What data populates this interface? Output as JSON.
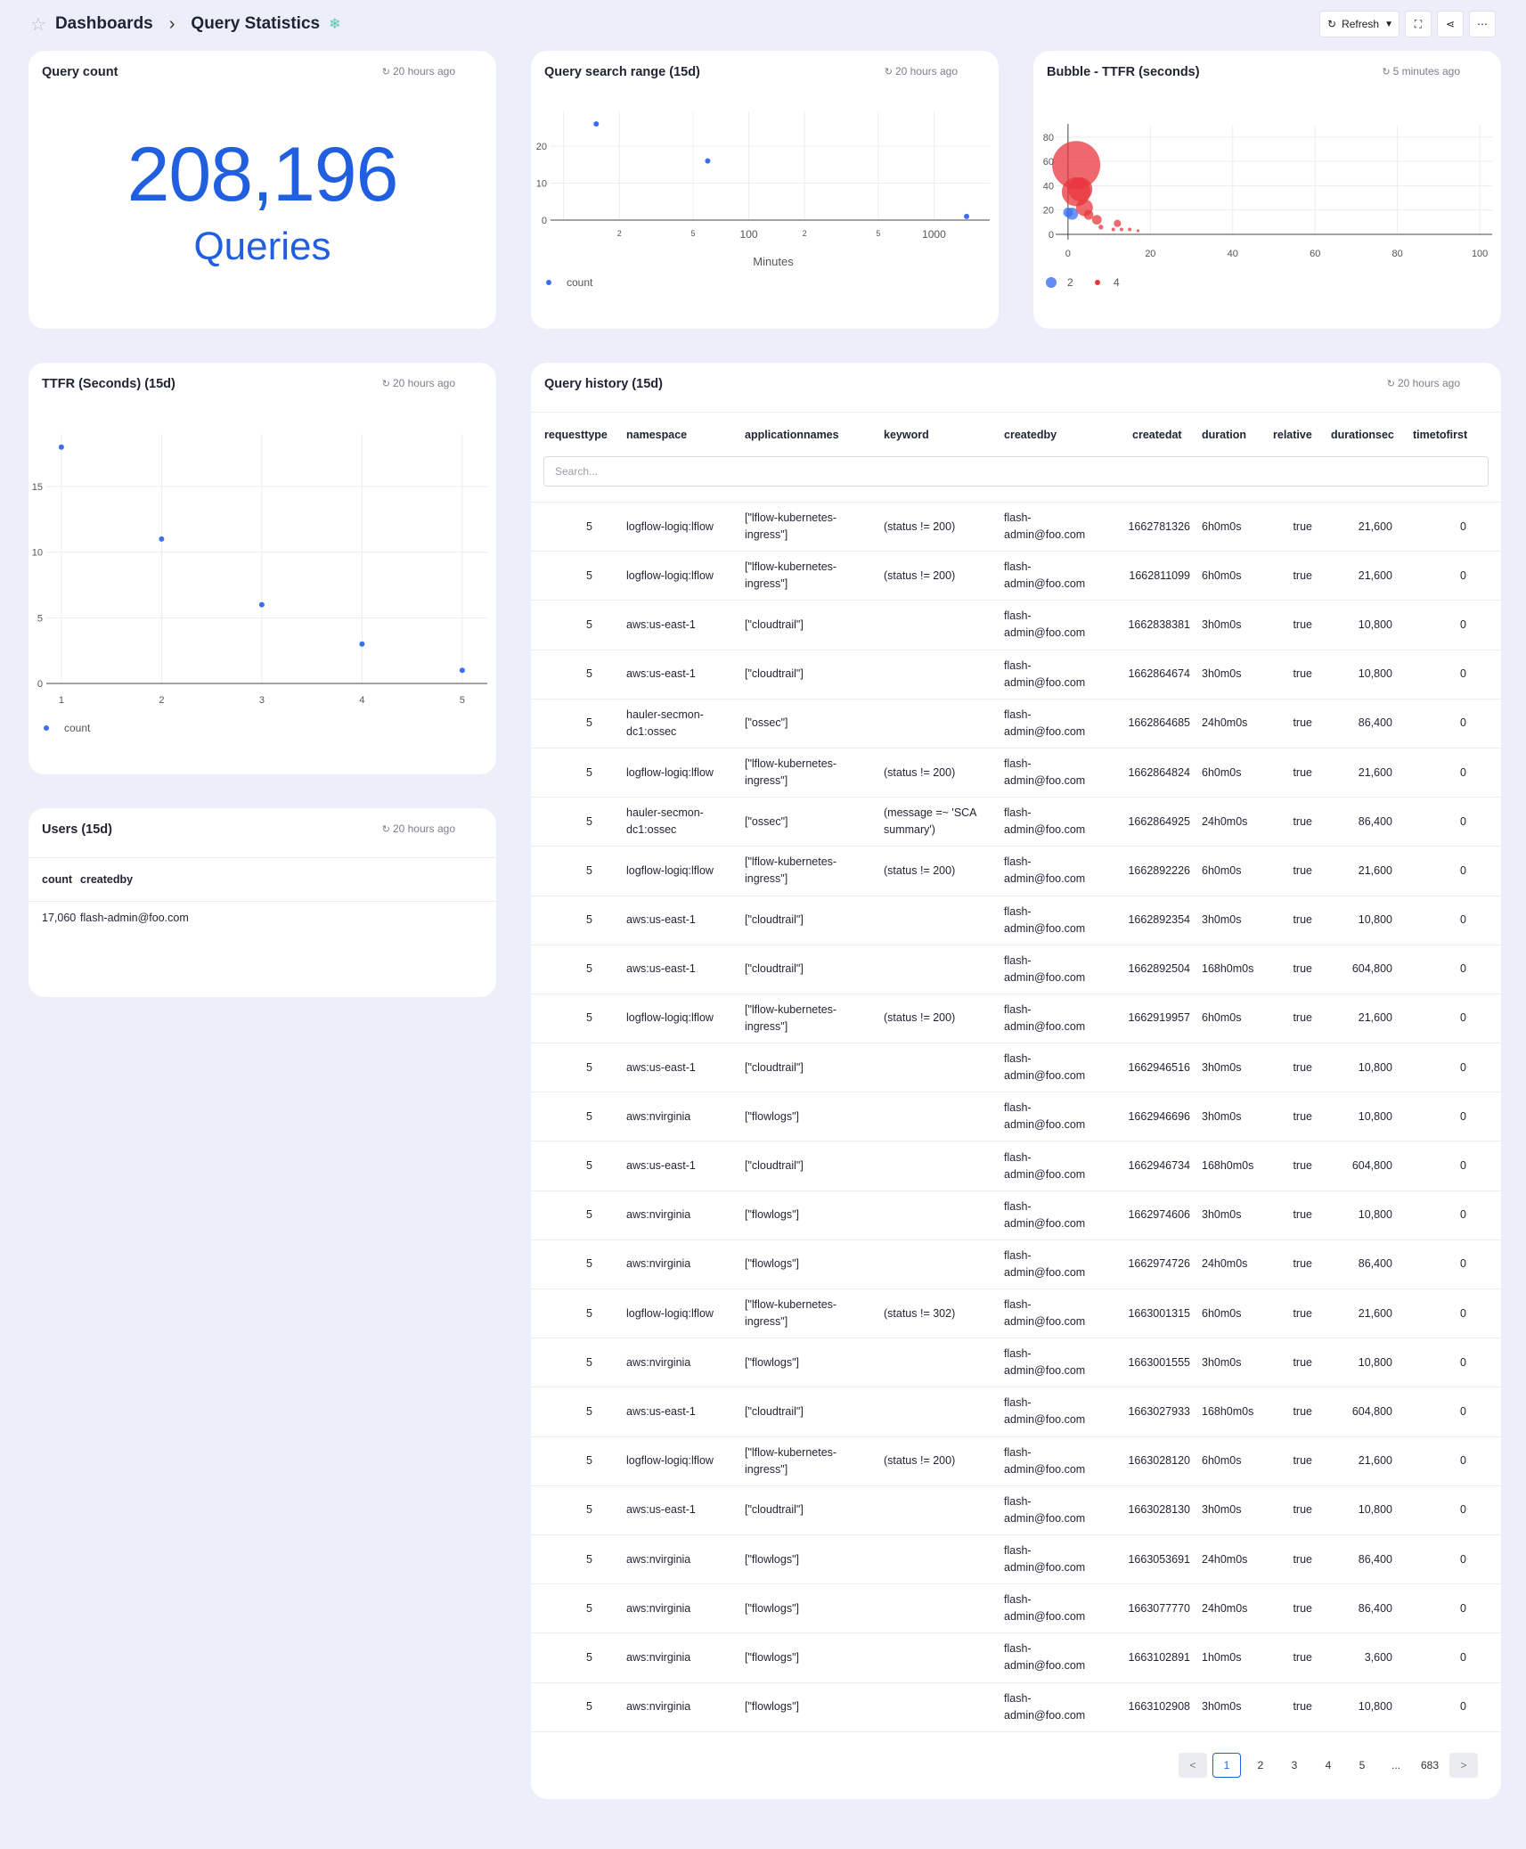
{
  "breadcrumb": {
    "root": "Dashboards",
    "current": "Query Statistics"
  },
  "toolbar": {
    "refresh_label": "Refresh"
  },
  "query_count": {
    "title": "Query count",
    "updated": "20 hours ago",
    "value": "208,196",
    "unit": "Queries"
  },
  "search_range": {
    "title": "Query search range (15d)",
    "updated": "20 hours ago",
    "xlabel": "Minutes",
    "legend": "count",
    "ytick_labels": [
      "20",
      "10",
      "0"
    ],
    "xtick_labels": [
      "2",
      "5",
      "100",
      "2",
      "5",
      "1000"
    ]
  },
  "bubble": {
    "title": "Bubble - TTFR (seconds)",
    "updated": "5 minutes ago",
    "ytick_labels": [
      "80",
      "60",
      "40",
      "20",
      "0"
    ],
    "xtick_labels": [
      "0",
      "20",
      "40",
      "60",
      "80",
      "100"
    ],
    "legend": [
      "2",
      "4"
    ]
  },
  "ttfr": {
    "title": "TTFR (Seconds) (15d)",
    "updated": "20 hours ago",
    "legend": "count",
    "ytick_labels": [
      "15",
      "10",
      "5",
      "0"
    ],
    "xtick_labels": [
      "1",
      "2",
      "3",
      "4",
      "5"
    ]
  },
  "users": {
    "title": "Users (15d)",
    "updated": "20 hours ago",
    "columns": [
      "count",
      "createdby"
    ],
    "rows": [
      {
        "count": "17,060",
        "createdby": "flash-admin@foo.com"
      }
    ]
  },
  "history": {
    "title": "Query history (15d)",
    "updated": "20 hours ago",
    "columns": [
      "requesttype",
      "namespace",
      "applicationnames",
      "keyword",
      "createdby",
      "createdat",
      "duration",
      "relative",
      "durationsec",
      "timetofirst"
    ],
    "search_placeholder": "Search...",
    "rows": [
      {
        "rt": "5",
        "ns": [
          "logflow-logiq:lflow"
        ],
        "app": [
          "[\"lflow-kubernetes-",
          "ingress\"]"
        ],
        "kw": [
          "(status != 200)"
        ],
        "cb": [
          "flash-",
          "admin@foo.com"
        ],
        "ca": "1662781326",
        "du": "6h0m0s",
        "rel": "true",
        "ds": "21,600",
        "tf": "0"
      },
      {
        "rt": "5",
        "ns": [
          "logflow-logiq:lflow"
        ],
        "app": [
          "[\"lflow-kubernetes-",
          "ingress\"]"
        ],
        "kw": [
          "(status != 200)"
        ],
        "cb": [
          "flash-",
          "admin@foo.com"
        ],
        "ca": "1662811099",
        "du": "6h0m0s",
        "rel": "true",
        "ds": "21,600",
        "tf": "0"
      },
      {
        "rt": "5",
        "ns": [
          "aws:us-east-1"
        ],
        "app": [
          "[\"cloudtrail\"]"
        ],
        "kw": [],
        "cb": [
          "flash-",
          "admin@foo.com"
        ],
        "ca": "1662838381",
        "du": "3h0m0s",
        "rel": "true",
        "ds": "10,800",
        "tf": "0"
      },
      {
        "rt": "5",
        "ns": [
          "aws:us-east-1"
        ],
        "app": [
          "[\"cloudtrail\"]"
        ],
        "kw": [],
        "cb": [
          "flash-",
          "admin@foo.com"
        ],
        "ca": "1662864674",
        "du": "3h0m0s",
        "rel": "true",
        "ds": "10,800",
        "tf": "0"
      },
      {
        "rt": "5",
        "ns": [
          "hauler-secmon-",
          "dc1:ossec"
        ],
        "app": [
          "[\"ossec\"]"
        ],
        "kw": [],
        "cb": [
          "flash-",
          "admin@foo.com"
        ],
        "ca": "1662864685",
        "du": "24h0m0s",
        "rel": "true",
        "ds": "86,400",
        "tf": "0"
      },
      {
        "rt": "5",
        "ns": [
          "logflow-logiq:lflow"
        ],
        "app": [
          "[\"lflow-kubernetes-",
          "ingress\"]"
        ],
        "kw": [
          "(status != 200)"
        ],
        "cb": [
          "flash-",
          "admin@foo.com"
        ],
        "ca": "1662864824",
        "du": "6h0m0s",
        "rel": "true",
        "ds": "21,600",
        "tf": "0"
      },
      {
        "rt": "5",
        "ns": [
          "hauler-secmon-",
          "dc1:ossec"
        ],
        "app": [
          "[\"ossec\"]"
        ],
        "kw": [
          "(message =~ 'SCA",
          "summary')"
        ],
        "cb": [
          "flash-",
          "admin@foo.com"
        ],
        "ca": "1662864925",
        "du": "24h0m0s",
        "rel": "true",
        "ds": "86,400",
        "tf": "0"
      },
      {
        "rt": "5",
        "ns": [
          "logflow-logiq:lflow"
        ],
        "app": [
          "[\"lflow-kubernetes-",
          "ingress\"]"
        ],
        "kw": [
          "(status != 200)"
        ],
        "cb": [
          "flash-",
          "admin@foo.com"
        ],
        "ca": "1662892226",
        "du": "6h0m0s",
        "rel": "true",
        "ds": "21,600",
        "tf": "0"
      },
      {
        "rt": "5",
        "ns": [
          "aws:us-east-1"
        ],
        "app": [
          "[\"cloudtrail\"]"
        ],
        "kw": [],
        "cb": [
          "flash-",
          "admin@foo.com"
        ],
        "ca": "1662892354",
        "du": "3h0m0s",
        "rel": "true",
        "ds": "10,800",
        "tf": "0"
      },
      {
        "rt": "5",
        "ns": [
          "aws:us-east-1"
        ],
        "app": [
          "[\"cloudtrail\"]"
        ],
        "kw": [],
        "cb": [
          "flash-",
          "admin@foo.com"
        ],
        "ca": "1662892504",
        "du": "168h0m0s",
        "rel": "true",
        "ds": "604,800",
        "tf": "0"
      },
      {
        "rt": "5",
        "ns": [
          "logflow-logiq:lflow"
        ],
        "app": [
          "[\"lflow-kubernetes-",
          "ingress\"]"
        ],
        "kw": [
          "(status != 200)"
        ],
        "cb": [
          "flash-",
          "admin@foo.com"
        ],
        "ca": "1662919957",
        "du": "6h0m0s",
        "rel": "true",
        "ds": "21,600",
        "tf": "0"
      },
      {
        "rt": "5",
        "ns": [
          "aws:us-east-1"
        ],
        "app": [
          "[\"cloudtrail\"]"
        ],
        "kw": [],
        "cb": [
          "flash-",
          "admin@foo.com"
        ],
        "ca": "1662946516",
        "du": "3h0m0s",
        "rel": "true",
        "ds": "10,800",
        "tf": "0"
      },
      {
        "rt": "5",
        "ns": [
          "aws:nvirginia"
        ],
        "app": [
          "[\"flowlogs\"]"
        ],
        "kw": [],
        "cb": [
          "flash-",
          "admin@foo.com"
        ],
        "ca": "1662946696",
        "du": "3h0m0s",
        "rel": "true",
        "ds": "10,800",
        "tf": "0"
      },
      {
        "rt": "5",
        "ns": [
          "aws:us-east-1"
        ],
        "app": [
          "[\"cloudtrail\"]"
        ],
        "kw": [],
        "cb": [
          "flash-",
          "admin@foo.com"
        ],
        "ca": "1662946734",
        "du": "168h0m0s",
        "rel": "true",
        "ds": "604,800",
        "tf": "0"
      },
      {
        "rt": "5",
        "ns": [
          "aws:nvirginia"
        ],
        "app": [
          "[\"flowlogs\"]"
        ],
        "kw": [],
        "cb": [
          "flash-",
          "admin@foo.com"
        ],
        "ca": "1662974606",
        "du": "3h0m0s",
        "rel": "true",
        "ds": "10,800",
        "tf": "0"
      },
      {
        "rt": "5",
        "ns": [
          "aws:nvirginia"
        ],
        "app": [
          "[\"flowlogs\"]"
        ],
        "kw": [],
        "cb": [
          "flash-",
          "admin@foo.com"
        ],
        "ca": "1662974726",
        "du": "24h0m0s",
        "rel": "true",
        "ds": "86,400",
        "tf": "0"
      },
      {
        "rt": "5",
        "ns": [
          "logflow-logiq:lflow"
        ],
        "app": [
          "[\"lflow-kubernetes-",
          "ingress\"]"
        ],
        "kw": [
          "(status != 302)"
        ],
        "cb": [
          "flash-",
          "admin@foo.com"
        ],
        "ca": "1663001315",
        "du": "6h0m0s",
        "rel": "true",
        "ds": "21,600",
        "tf": "0"
      },
      {
        "rt": "5",
        "ns": [
          "aws:nvirginia"
        ],
        "app": [
          "[\"flowlogs\"]"
        ],
        "kw": [],
        "cb": [
          "flash-",
          "admin@foo.com"
        ],
        "ca": "1663001555",
        "du": "3h0m0s",
        "rel": "true",
        "ds": "10,800",
        "tf": "0"
      },
      {
        "rt": "5",
        "ns": [
          "aws:us-east-1"
        ],
        "app": [
          "[\"cloudtrail\"]"
        ],
        "kw": [],
        "cb": [
          "flash-",
          "admin@foo.com"
        ],
        "ca": "1663027933",
        "du": "168h0m0s",
        "rel": "true",
        "ds": "604,800",
        "tf": "0"
      },
      {
        "rt": "5",
        "ns": [
          "logflow-logiq:lflow"
        ],
        "app": [
          "[\"lflow-kubernetes-",
          "ingress\"]"
        ],
        "kw": [
          "(status != 200)"
        ],
        "cb": [
          "flash-",
          "admin@foo.com"
        ],
        "ca": "1663028120",
        "du": "6h0m0s",
        "rel": "true",
        "ds": "21,600",
        "tf": "0"
      },
      {
        "rt": "5",
        "ns": [
          "aws:us-east-1"
        ],
        "app": [
          "[\"cloudtrail\"]"
        ],
        "kw": [],
        "cb": [
          "flash-",
          "admin@foo.com"
        ],
        "ca": "1663028130",
        "du": "3h0m0s",
        "rel": "true",
        "ds": "10,800",
        "tf": "0"
      },
      {
        "rt": "5",
        "ns": [
          "aws:nvirginia"
        ],
        "app": [
          "[\"flowlogs\"]"
        ],
        "kw": [],
        "cb": [
          "flash-",
          "admin@foo.com"
        ],
        "ca": "1663053691",
        "du": "24h0m0s",
        "rel": "true",
        "ds": "86,400",
        "tf": "0"
      },
      {
        "rt": "5",
        "ns": [
          "aws:nvirginia"
        ],
        "app": [
          "[\"flowlogs\"]"
        ],
        "kw": [],
        "cb": [
          "flash-",
          "admin@foo.com"
        ],
        "ca": "1663077770",
        "du": "24h0m0s",
        "rel": "true",
        "ds": "86,400",
        "tf": "0"
      },
      {
        "rt": "5",
        "ns": [
          "aws:nvirginia"
        ],
        "app": [
          "[\"flowlogs\"]"
        ],
        "kw": [],
        "cb": [
          "flash-",
          "admin@foo.com"
        ],
        "ca": "1663102891",
        "du": "1h0m0s",
        "rel": "true",
        "ds": "3,600",
        "tf": "0"
      },
      {
        "rt": "5",
        "ns": [
          "aws:nvirginia"
        ],
        "app": [
          "[\"flowlogs\"]"
        ],
        "kw": [],
        "cb": [
          "flash-",
          "admin@foo.com"
        ],
        "ca": "1663102908",
        "du": "3h0m0s",
        "rel": "true",
        "ds": "10,800",
        "tf": "0"
      }
    ],
    "pagination": {
      "pages": [
        "1",
        "2",
        "3",
        "4",
        "5"
      ],
      "ellipsis": "...",
      "last": "683",
      "prev": "<",
      "next": ">"
    }
  },
  "colors": {
    "accent": "#1f5fe0",
    "series_blue": "#3b6ff0",
    "series_red": "#e8363d"
  },
  "chart_data": [
    {
      "type": "scatter",
      "title": "Query search range (15d)",
      "xlabel": "Minutes",
      "x_scale": "log",
      "series": [
        {
          "name": "count",
          "x": [
            15,
            60,
            1500
          ],
          "y": [
            26,
            16,
            1
          ]
        }
      ],
      "ylim": [
        0,
        27
      ],
      "legend": "bottom-left"
    },
    {
      "type": "bubble",
      "title": "Bubble - TTFR (seconds)",
      "xlim": [
        -3,
        103
      ],
      "ylim": [
        0,
        85
      ],
      "series": [
        {
          "name": "2",
          "points": [
            {
              "x": 1,
              "y": 17,
              "r": 5
            },
            {
              "x": 0,
              "y": 18,
              "r": 4
            }
          ]
        },
        {
          "name": "4",
          "points": [
            {
              "x": 2,
              "y": 57,
              "r": 20
            },
            {
              "x": 2,
              "y": 35,
              "r": 12
            },
            {
              "x": 3,
              "y": 37,
              "r": 10
            },
            {
              "x": 4,
              "y": 22,
              "r": 7
            },
            {
              "x": 5,
              "y": 16,
              "r": 4
            },
            {
              "x": 7,
              "y": 12,
              "r": 4
            },
            {
              "x": 12,
              "y": 9,
              "r": 3
            },
            {
              "x": 8,
              "y": 6,
              "r": 2
            },
            {
              "x": 11,
              "y": 4,
              "r": 1.5
            },
            {
              "x": 13,
              "y": 4,
              "r": 1.5
            },
            {
              "x": 15,
              "y": 4,
              "r": 1.5
            },
            {
              "x": 17,
              "y": 3,
              "r": 1.2
            }
          ]
        }
      ],
      "legend": "bottom-left"
    },
    {
      "type": "scatter",
      "title": "TTFR (Seconds) (15d)",
      "series": [
        {
          "name": "count",
          "x": [
            1,
            2,
            3,
            4,
            5
          ],
          "y": [
            18,
            11,
            6,
            3,
            1
          ]
        }
      ],
      "xlim": [
        0.85,
        5.25
      ],
      "ylim": [
        0,
        19
      ],
      "legend": "bottom-left"
    }
  ]
}
